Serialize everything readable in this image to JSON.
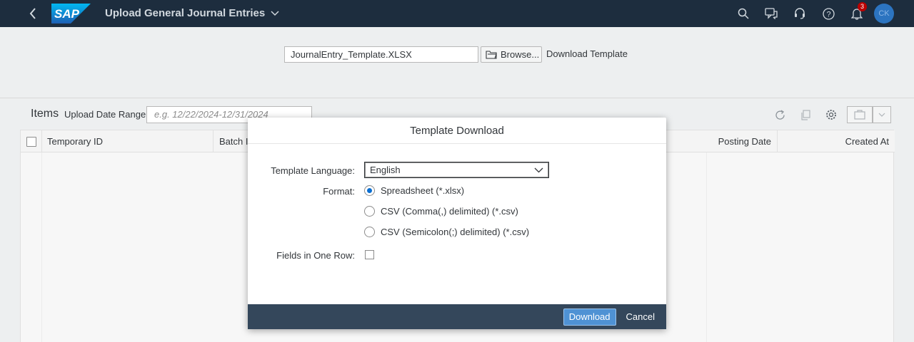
{
  "shell": {
    "app_title": "Upload General Journal Entries",
    "notification_count": "3",
    "avatar_initials": "CK",
    "colors": {
      "shell_bg": "#1d2d3e",
      "accent": "#0a6ed1",
      "badge": "#bb0000"
    }
  },
  "upload": {
    "file_name": "JournalEntry_Template.XLSX",
    "browse_label": "Browse...",
    "download_template_label": "Download Template"
  },
  "items": {
    "title": "Items",
    "date_range_label": "Upload Date Range",
    "date_range_placeholder": "e.g. 12/22/2024-12/31/2024"
  },
  "table": {
    "columns": [
      "Temporary ID",
      "Batch ID",
      "Posting Date",
      "Created At"
    ]
  },
  "dialog": {
    "title": "Template Download",
    "language_label": "Template Language:",
    "language_value": "English",
    "format_label": "Format:",
    "formats": [
      {
        "label": "Spreadsheet (*.xlsx)",
        "selected": true
      },
      {
        "label": "CSV (Comma(,) delimited) (*.csv)",
        "selected": false
      },
      {
        "label": "CSV (Semicolon(;) delimited) (*.csv)",
        "selected": false
      }
    ],
    "fields_label": "Fields in One Row:",
    "download_label": "Download",
    "cancel_label": "Cancel"
  }
}
